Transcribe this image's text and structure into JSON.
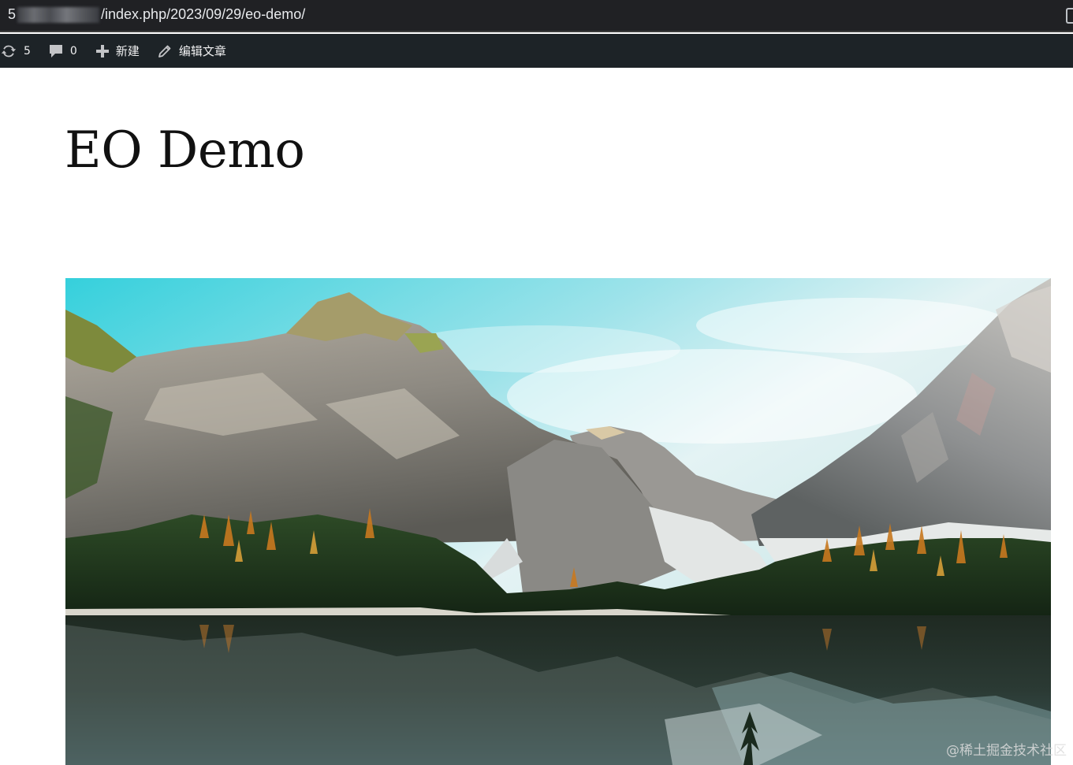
{
  "browser": {
    "url_prefix": "5",
    "url_path": "/index.php/2023/09/29/eo-demo/"
  },
  "admin_bar": {
    "updates_count": "5",
    "comments_count": "0",
    "new_label": "新建",
    "edit_label": "编辑文章"
  },
  "post": {
    "title": "EO Demo"
  },
  "watermark": "@稀土掘金技术社区",
  "colors": {
    "address_bar_bg": "#202124",
    "admin_bar_bg": "#1d2327",
    "admin_bar_text": "#f0f0f1"
  },
  "icons": {
    "updates": "refresh-icon",
    "comments": "comment-bubble-icon",
    "new": "plus-icon",
    "edit": "pencil-icon"
  }
}
